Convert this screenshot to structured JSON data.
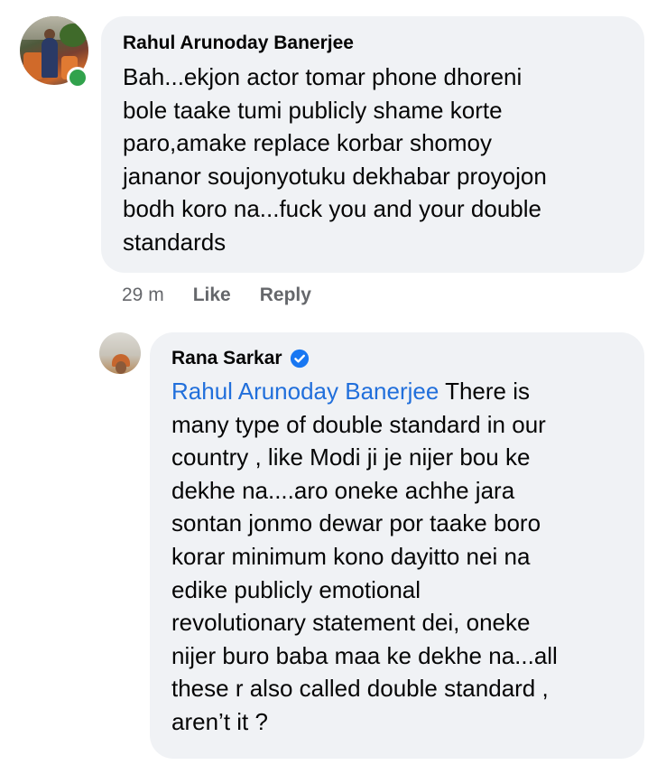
{
  "comments": [
    {
      "author": "Rahul Arunoday Banerjee",
      "online": true,
      "text": "Bah...ekjon actor tomar phone dhoreni\nbole taake tumi publicly shame korte\nparo,amake replace korbar shomoy\njananor soujonyotuku dekhabar proyojon\nbodh koro na...fuck you and your double\nstandards",
      "time": "29 m",
      "like_label": "Like",
      "reply_label": "Reply"
    }
  ],
  "reply": {
    "author": "Rana Sarkar",
    "verified_icon": "verified-badge-icon",
    "mention": "Rahul Arunoday Banerjee",
    "text_first_line_rest": " There is",
    "text": "many type of double standard in our\ncountry , like Modi ji je nijer bou ke\ndekhe na....aro oneke achhe jara\nsontan jonmo dewar por taake boro\nkorar minimum kono dayitto nei na\nedike publicly emotional\nrevolutionary statement dei, oneke\nnijer buro baba maa ke dekhe na...all\nthese r also called double standard ,\naren’t it ?"
  },
  "colors": {
    "bubble": "#f0f2f5",
    "online": "#31a24c",
    "mention": "#216fdb",
    "meta": "#65676b",
    "verified": "#1877f2"
  }
}
